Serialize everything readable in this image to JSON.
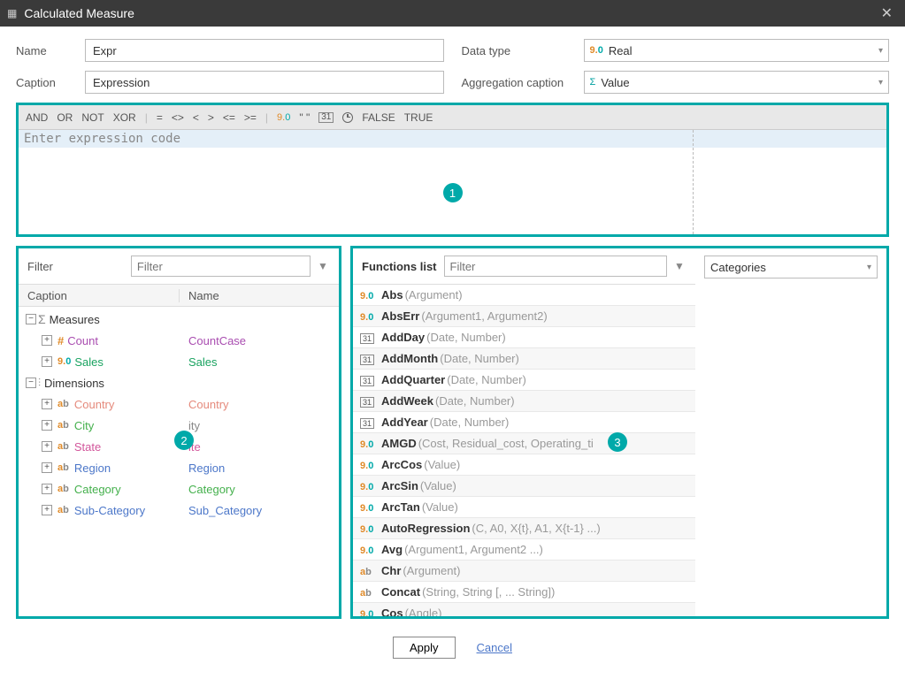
{
  "window_title": "Calculated Measure",
  "form": {
    "name_label": "Name",
    "name_value": "Expr",
    "datatype_label": "Data type",
    "datatype_value": "Real",
    "caption_label": "Caption",
    "caption_value": "Expression",
    "aggcaption_label": "Aggregation caption",
    "aggcaption_value": "Value"
  },
  "expr_toolbar": {
    "and": "AND",
    "or": "OR",
    "not": "NOT",
    "xor": "XOR",
    "eq": "=",
    "neq": "<>",
    "lt": "<",
    "gt": ">",
    "lte": "<=",
    "gte": ">=",
    "quotes": "\" \"",
    "false": "FALSE",
    "true": "TRUE"
  },
  "expr_placeholder": "Enter expression code",
  "badges": {
    "b1": "1",
    "b2": "2",
    "b3": "3"
  },
  "left_panel": {
    "filter_label": "Filter",
    "filter_placeholder": "Filter",
    "hdr_caption": "Caption",
    "hdr_name": "Name",
    "measures_label": "Measures",
    "dimensions_label": "Dimensions",
    "rows": [
      {
        "caption": "Count",
        "name": "CountCase",
        "color": "c-purple",
        "icon": "hash"
      },
      {
        "caption": "Sales",
        "name": "Sales",
        "color": "c-teal2",
        "icon": "num"
      }
    ],
    "dims": [
      {
        "caption": "Country",
        "name": "Country",
        "cc": "c-salmon",
        "nc": "c-salmon"
      },
      {
        "caption": "City",
        "name": "ity",
        "cc": "c-green",
        "nc": "c-gray"
      },
      {
        "caption": "State",
        "name": "ite",
        "cc": "c-magenta",
        "nc": "c-magenta"
      },
      {
        "caption": "Region",
        "name": "Region",
        "cc": "c-blue",
        "nc": "c-blue"
      },
      {
        "caption": "Category",
        "name": "Category",
        "cc": "c-green",
        "nc": "c-green"
      },
      {
        "caption": "Sub-Category",
        "name": "Sub_Category",
        "cc": "c-blue",
        "nc": "c-blue"
      }
    ]
  },
  "right_panel": {
    "functions_label": "Functions list",
    "filter_placeholder": "Filter",
    "categories_label": "Categories",
    "functions": [
      {
        "icon": "num",
        "name": "Abs",
        "args": "(Argument)"
      },
      {
        "icon": "num",
        "name": "AbsErr",
        "args": "(Argument1, Argument2)"
      },
      {
        "icon": "date",
        "name": "AddDay",
        "args": "(Date, Number)"
      },
      {
        "icon": "date",
        "name": "AddMonth",
        "args": "(Date, Number)"
      },
      {
        "icon": "date",
        "name": "AddQuarter",
        "args": "(Date, Number)"
      },
      {
        "icon": "date",
        "name": "AddWeek",
        "args": "(Date, Number)"
      },
      {
        "icon": "date",
        "name": "AddYear",
        "args": "(Date, Number)"
      },
      {
        "icon": "num",
        "name": "AMGD",
        "args": "(Cost, Residual_cost, Operating_ti"
      },
      {
        "icon": "num",
        "name": "ArcCos",
        "args": "(Value)"
      },
      {
        "icon": "num",
        "name": "ArcSin",
        "args": "(Value)"
      },
      {
        "icon": "num",
        "name": "ArcTan",
        "args": "(Value)"
      },
      {
        "icon": "num",
        "name": "AutoRegression",
        "args": "(C, A0, X{t}, A1, X{t-1} ...)"
      },
      {
        "icon": "num",
        "name": "Avg",
        "args": "(Argument1, Argument2 ...)"
      },
      {
        "icon": "ab",
        "name": "Chr",
        "args": "(Argument)"
      },
      {
        "icon": "ab",
        "name": "Concat",
        "args": "(String, String [, ... String])"
      },
      {
        "icon": "num",
        "name": "Cos",
        "args": "(Angle)"
      }
    ]
  },
  "footer": {
    "apply": "Apply",
    "cancel": "Cancel"
  }
}
